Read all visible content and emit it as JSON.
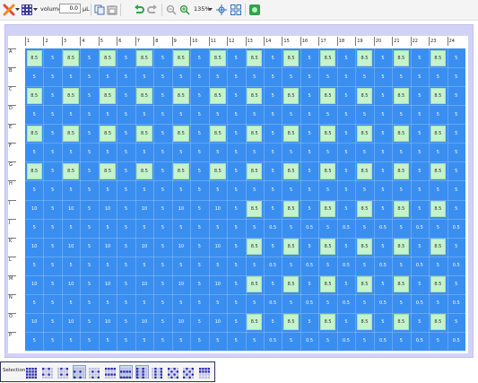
{
  "toolbar": {
    "volume_label": "volume",
    "volume_value": "0.0",
    "volume_unit": "µL",
    "zoom_value": "135%"
  },
  "plate": {
    "columns": [
      "1",
      "2",
      "3",
      "4",
      "5",
      "6",
      "7",
      "8",
      "9",
      "10",
      "11",
      "12",
      "13",
      "14",
      "15",
      "16",
      "17",
      "18",
      "19",
      "20",
      "21",
      "22",
      "23",
      "24"
    ],
    "rows": [
      "A",
      "B",
      "C",
      "D",
      "E",
      "F",
      "G",
      "H",
      "I",
      "J",
      "K",
      "L",
      "M",
      "N",
      "O",
      "P"
    ],
    "wells": [
      [
        "8.5",
        "5",
        "8.5",
        "5",
        "8.5",
        "5",
        "8.5",
        "5",
        "8.5",
        "5",
        "8.5",
        "5",
        "8.5",
        "5",
        "8.5",
        "5",
        "8.5",
        "5",
        "8.5",
        "5",
        "8.5",
        "5",
        "8.5",
        "5"
      ],
      [
        "5",
        "5",
        "5",
        "5",
        "5",
        "5",
        "5",
        "5",
        "5",
        "5",
        "5",
        "5",
        "5",
        "5",
        "5",
        "5",
        "5",
        "5",
        "5",
        "5",
        "5",
        "5",
        "5",
        "5"
      ],
      [
        "8.5",
        "5",
        "8.5",
        "5",
        "8.5",
        "5",
        "8.5",
        "5",
        "8.5",
        "5",
        "8.5",
        "5",
        "8.5",
        "5",
        "8.5",
        "5",
        "8.5",
        "5",
        "8.5",
        "5",
        "8.5",
        "5",
        "8.5",
        "5"
      ],
      [
        "5",
        "5",
        "5",
        "5",
        "5",
        "5",
        "5",
        "5",
        "5",
        "5",
        "5",
        "5",
        "5",
        "5",
        "5",
        "5",
        "5",
        "5",
        "5",
        "5",
        "5",
        "5",
        "5",
        "5"
      ],
      [
        "8.5",
        "5",
        "8.5",
        "5",
        "8.5",
        "5",
        "8.5",
        "5",
        "8.5",
        "5",
        "8.5",
        "5",
        "8.5",
        "5",
        "8.5",
        "5",
        "8.5",
        "5",
        "8.5",
        "5",
        "8.5",
        "5",
        "8.5",
        "5"
      ],
      [
        "5",
        "5",
        "5",
        "5",
        "5",
        "5",
        "5",
        "5",
        "5",
        "5",
        "5",
        "5",
        "5",
        "5",
        "5",
        "5",
        "5",
        "5",
        "5",
        "5",
        "5",
        "5",
        "5",
        "5"
      ],
      [
        "8.5",
        "5",
        "8.5",
        "5",
        "8.5",
        "5",
        "8.5",
        "5",
        "8.5",
        "5",
        "8.5",
        "5",
        "8.5",
        "5",
        "8.5",
        "5",
        "8.5",
        "5",
        "8.5",
        "5",
        "8.5",
        "5",
        "8.5",
        "5"
      ],
      [
        "5",
        "5",
        "5",
        "5",
        "5",
        "5",
        "5",
        "5",
        "5",
        "5",
        "5",
        "5",
        "5",
        "5",
        "5",
        "5",
        "5",
        "5",
        "5",
        "5",
        "5",
        "5",
        "5",
        "5"
      ],
      [
        "10",
        "5",
        "10",
        "5",
        "10",
        "5",
        "10",
        "5",
        "10",
        "5",
        "10",
        "5",
        "8.5",
        "5",
        "8.5",
        "5",
        "8.5",
        "5",
        "8.5",
        "5",
        "8.5",
        "5",
        "8.5",
        "5"
      ],
      [
        "5",
        "5",
        "5",
        "5",
        "5",
        "5",
        "5",
        "5",
        "5",
        "5",
        "5",
        "5",
        "5",
        "0.5",
        "5",
        "0.5",
        "5",
        "0.5",
        "5",
        "0.5",
        "5",
        "0.5",
        "5",
        "0.5"
      ],
      [
        "10",
        "5",
        "10",
        "5",
        "10",
        "5",
        "10",
        "5",
        "10",
        "5",
        "10",
        "5",
        "8.5",
        "5",
        "8.5",
        "5",
        "8.5",
        "5",
        "8.5",
        "5",
        "8.5",
        "5",
        "8.5",
        "5"
      ],
      [
        "5",
        "5",
        "5",
        "5",
        "5",
        "5",
        "5",
        "5",
        "5",
        "5",
        "5",
        "5",
        "5",
        "0.5",
        "5",
        "0.5",
        "5",
        "0.5",
        "5",
        "0.5",
        "5",
        "0.5",
        "5",
        "0.5"
      ],
      [
        "10",
        "5",
        "10",
        "5",
        "10",
        "5",
        "10",
        "5",
        "10",
        "5",
        "10",
        "5",
        "8.5",
        "5",
        "8.5",
        "5",
        "8.5",
        "5",
        "8.5",
        "5",
        "8.5",
        "5",
        "8.5",
        "5"
      ],
      [
        "5",
        "5",
        "5",
        "5",
        "5",
        "5",
        "5",
        "5",
        "5",
        "5",
        "5",
        "5",
        "5",
        "0.5",
        "5",
        "0.5",
        "5",
        "0.5",
        "5",
        "0.5",
        "5",
        "0.5",
        "5",
        "0.5"
      ],
      [
        "10",
        "5",
        "10",
        "5",
        "10",
        "5",
        "10",
        "5",
        "10",
        "5",
        "10",
        "5",
        "8.5",
        "5",
        "8.5",
        "5",
        "8.5",
        "5",
        "8.5",
        "5",
        "8.5",
        "5",
        "8.5",
        "5"
      ],
      [
        "5",
        "5",
        "5",
        "5",
        "5",
        "5",
        "5",
        "5",
        "5",
        "5",
        "5",
        "5",
        "5",
        "0.5",
        "5",
        "0.5",
        "5",
        "0.5",
        "5",
        "0.5",
        "5",
        "0.5",
        "5",
        "0.5"
      ]
    ],
    "highlight_value": "8.5"
  },
  "selection": {
    "label": "Selection",
    "patterns": [
      {
        "name": "select-all",
        "active": false
      },
      {
        "name": "select-quadrant-1",
        "active": false
      },
      {
        "name": "select-quadrant-2",
        "active": false
      },
      {
        "name": "select-quadrant-3",
        "active": true
      },
      {
        "name": "select-quadrant-4",
        "active": false
      },
      {
        "name": "select-rows-odd",
        "active": false
      },
      {
        "name": "select-rows-even",
        "active": true
      },
      {
        "name": "select-columns-odd",
        "active": true
      },
      {
        "name": "select-columns-even",
        "active": false
      },
      {
        "name": "select-checker-1",
        "active": false
      },
      {
        "name": "select-checker-2",
        "active": false
      },
      {
        "name": "select-block",
        "active": false
      }
    ]
  },
  "colors": {
    "well_blue": "#3a8ef0",
    "well_highlight": "#c5f3cb",
    "plate_border": "#d2d2f7",
    "undo_green": "#2fa24a"
  },
  "icons": [
    "tools-icon",
    "plate-grid-icon",
    "copy-icon",
    "paste-icon",
    "undo-icon",
    "redo-icon",
    "zoom-out-icon",
    "zoom-in-icon",
    "fit-icon",
    "layout-icon",
    "snapshot-icon"
  ]
}
